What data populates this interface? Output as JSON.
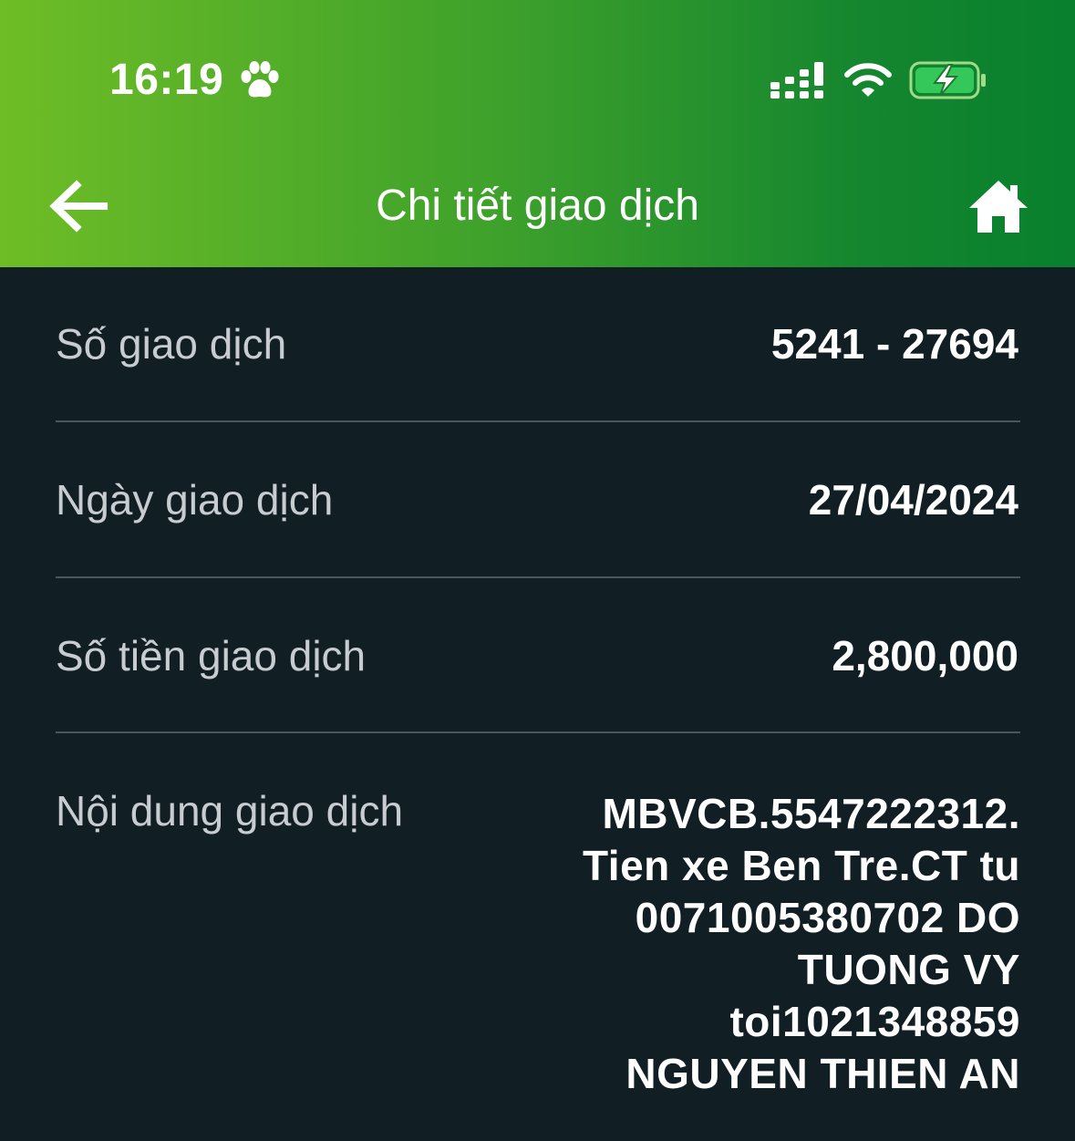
{
  "status_bar": {
    "time": "16:19"
  },
  "header": {
    "title": "Chi tiết giao dịch"
  },
  "details": {
    "transaction_number": {
      "label": "Số giao dịch",
      "value": "5241 - 27694"
    },
    "transaction_date": {
      "label": "Ngày giao dịch",
      "value": "27/04/2024"
    },
    "transaction_amount": {
      "label": "Số tiền giao dịch",
      "value": "2,800,000"
    },
    "transaction_content": {
      "label": "Nội dung giao dịch",
      "lines": [
        "MBVCB.5547222312.",
        "Tien xe Ben Tre.CT tu",
        "0071005380702 DO",
        "TUONG VY",
        "toi1021348859",
        "NGUYEN THIEN AN"
      ]
    }
  },
  "icons": {
    "status": [
      "paw-icon",
      "signal-icon",
      "wifi-icon",
      "battery-charging-icon"
    ],
    "navigation": [
      "back-arrow-icon",
      "home-icon"
    ]
  },
  "colors": {
    "header_gradient_start": "#6ebd26",
    "header_gradient_end": "#08802d",
    "background": "#111e24",
    "label_text": "#c6ccd0",
    "value_text": "#ffffff",
    "divider": "#4a555c",
    "battery_fill": "#34c759"
  }
}
